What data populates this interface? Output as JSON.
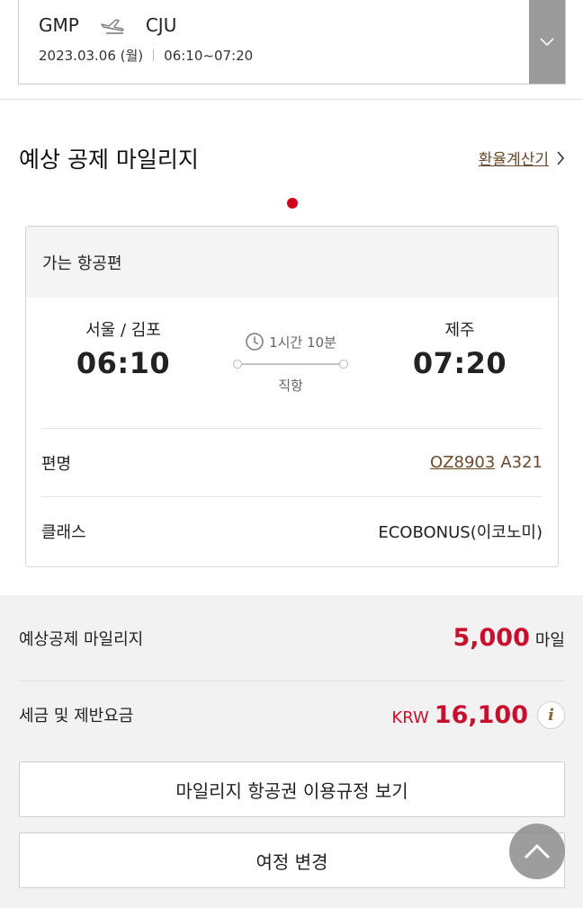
{
  "summary": {
    "origin": "GMP",
    "destination": "CJU",
    "date": "2023.03.06 (월)",
    "time_range": "06:10~07:20"
  },
  "section": {
    "title": "예상 공제 마일리지",
    "calc_link": "환율계산기"
  },
  "card": {
    "header": "가는 항공편",
    "departure": {
      "city": "서울 / 김포",
      "time": "06:10"
    },
    "arrival": {
      "city": "제주",
      "time": "07:20"
    },
    "duration": "1시간 10분",
    "stop_type": "직항",
    "flight_label": "편명",
    "flight_no": "OZ8903",
    "aircraft": "A321",
    "class_label": "클래스",
    "class_value": "ECOBONUS(이코노미)"
  },
  "mileage": {
    "label": "예상공제 마일리지",
    "value": "5,000",
    "unit": "마일"
  },
  "tax": {
    "label": "세금 및 제반요금",
    "currency": "KRW",
    "value": "16,100",
    "info_glyph": "i"
  },
  "buttons": {
    "rules": "마일리지 항공권 이용규정 보기",
    "change": "여정 변경"
  },
  "colors": {
    "accent_red": "#c8102e",
    "link_brown": "#6b4a2b"
  }
}
